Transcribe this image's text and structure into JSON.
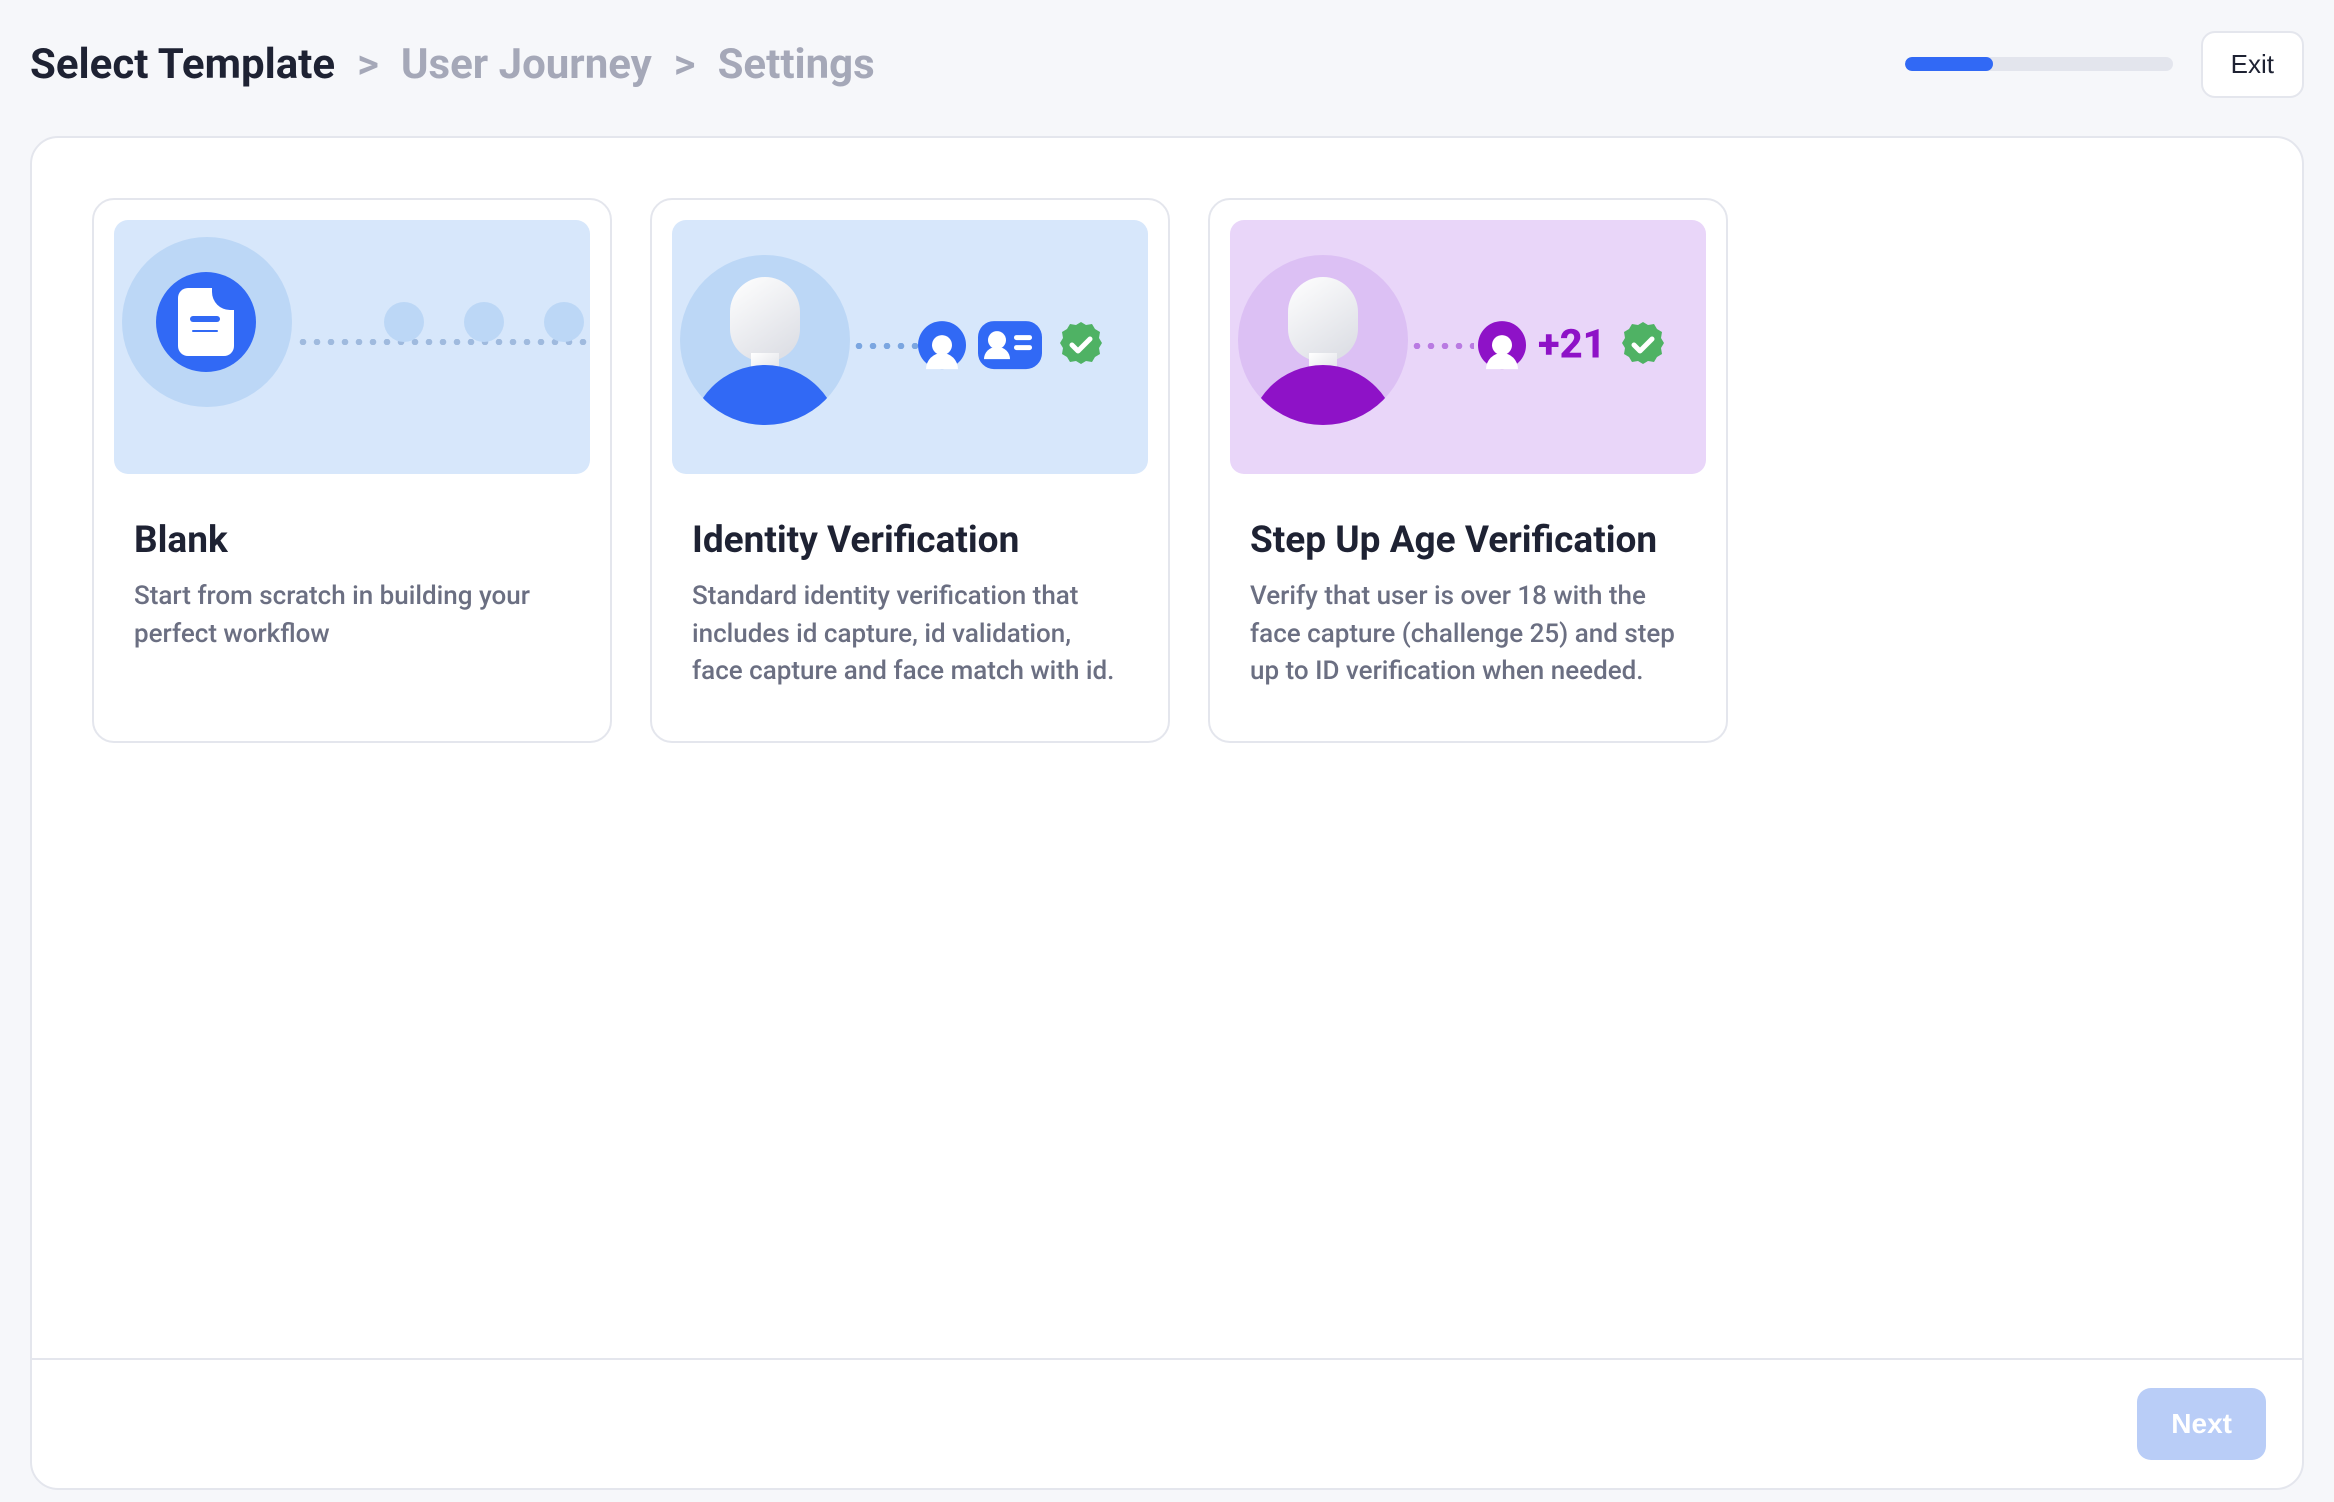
{
  "breadcrumb": {
    "step1": "Select Template",
    "step2": "User Journey",
    "step3": "Settings",
    "separator": ">"
  },
  "header": {
    "exit_label": "Exit",
    "progress_percent": 33
  },
  "templates": [
    {
      "title": "Blank",
      "description": "Start from scratch in building your perfect workflow"
    },
    {
      "title": "Identity Verification",
      "description": "Standard identity verification that includes id capture, id validation, face capture and face match with id."
    },
    {
      "title": "Step Up Age Verification",
      "description": "Verify that user is over 18 with the face capture (challenge 25) and step up to ID verification when needed.",
      "age_badge": "+21"
    }
  ],
  "footer": {
    "next_label": "Next"
  }
}
